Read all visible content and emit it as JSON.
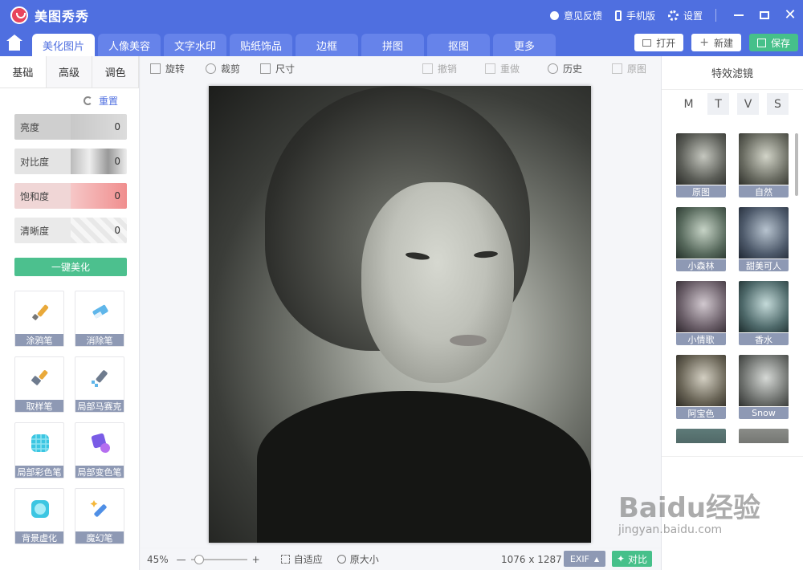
{
  "app": {
    "title": "美图秀秀"
  },
  "titlebar": {
    "feedback": "意见反馈",
    "mobile": "手机版",
    "settings": "设置"
  },
  "tabs": [
    {
      "label": "美化图片",
      "active": true
    },
    {
      "label": "人像美容"
    },
    {
      "label": "文字水印"
    },
    {
      "label": "贴纸饰品"
    },
    {
      "label": "边框"
    },
    {
      "label": "拼图"
    },
    {
      "label": "抠图"
    },
    {
      "label": "更多"
    }
  ],
  "actions": {
    "open": "打开",
    "new": "新建",
    "save": "保存"
  },
  "left": {
    "subtabs": [
      "基础",
      "高级",
      "调色"
    ],
    "reset": "重置",
    "sliders": [
      {
        "label": "亮度",
        "value": "0"
      },
      {
        "label": "对比度",
        "value": "0"
      },
      {
        "label": "饱和度",
        "value": "0"
      },
      {
        "label": "清晰度",
        "value": "0"
      }
    ],
    "one_key": "一键美化",
    "tools": [
      "涂鸦笔",
      "消除笔",
      "取样笔",
      "局部马赛克",
      "局部彩色笔",
      "局部变色笔",
      "背景虚化",
      "魔幻笔"
    ]
  },
  "toolbar": {
    "rotate": "旋转",
    "crop": "裁剪",
    "size": "尺寸",
    "undo": "撤销",
    "redo": "重做",
    "history": "历史",
    "original": "原图"
  },
  "bottombar": {
    "zoom": "45%",
    "minus": "—",
    "plus": "+",
    "fit": "自适应",
    "actual": "原大小",
    "dimensions": "1076 x 1287",
    "exif": "EXIF",
    "compare": "对比"
  },
  "right": {
    "title": "特效滤镜",
    "letters": [
      "M",
      "T",
      "V",
      "S"
    ],
    "filters": [
      "原图",
      "自然",
      "小森林",
      "甜美可人",
      "小情歌",
      "香水",
      "阿宝色",
      "Snow"
    ]
  },
  "watermark": {
    "brand": "Baidu经验",
    "url": "jingyan.baidu.com"
  },
  "colors": {
    "brand": "#4f6fe0",
    "save": "#46c08a",
    "label": "#8e99b4"
  }
}
